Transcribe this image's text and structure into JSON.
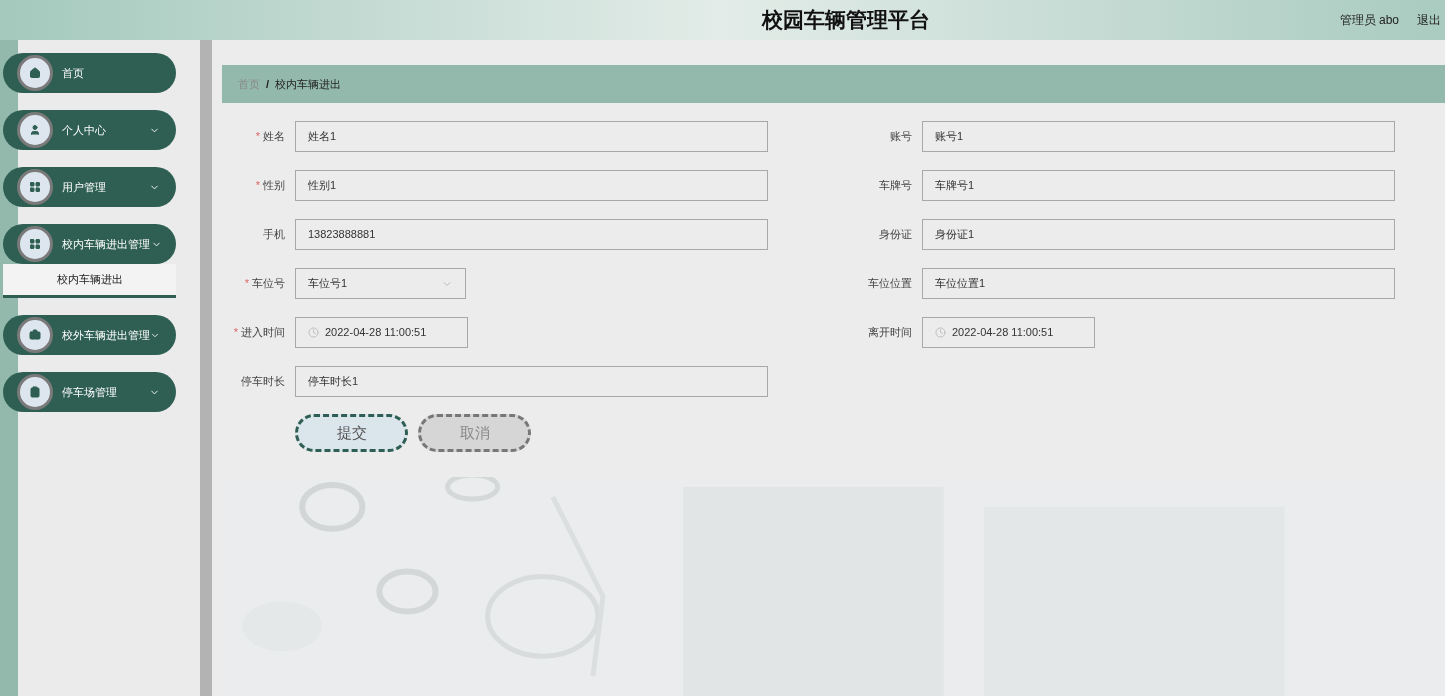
{
  "header": {
    "title": "校园车辆管理平台",
    "user": "管理员 abo",
    "logout": "退出"
  },
  "sidebar": {
    "items": [
      {
        "label": "首页",
        "kind": "link"
      },
      {
        "label": "个人中心",
        "kind": "menu",
        "expanded": false
      },
      {
        "label": "用户管理",
        "kind": "menu",
        "expanded": false
      },
      {
        "label": "校内车辆进出管理",
        "kind": "menu",
        "expanded": true,
        "children": [
          {
            "label": "校内车辆进出",
            "selected": true
          }
        ]
      },
      {
        "label": "校外车辆进出管理",
        "kind": "menu",
        "expanded": false
      },
      {
        "label": "停车场管理",
        "kind": "menu",
        "expanded": false
      }
    ]
  },
  "breadcrumb": {
    "items": [
      "首页",
      "校内车辆进出"
    ],
    "separator": "/"
  },
  "form": {
    "required_mark": "*",
    "rows": [
      [
        {
          "label": "姓名",
          "value": "姓名1",
          "required": true,
          "kind": "text"
        },
        {
          "label": "账号",
          "value": "账号1",
          "required": false,
          "kind": "text"
        }
      ],
      [
        {
          "label": "性别",
          "value": "性别1",
          "required": true,
          "kind": "text"
        },
        {
          "label": "车牌号",
          "value": "车牌号1",
          "required": false,
          "kind": "text"
        }
      ],
      [
        {
          "label": "手机",
          "value": "13823888881",
          "required": false,
          "kind": "text"
        },
        {
          "label": "身份证",
          "value": "身份证1",
          "required": false,
          "kind": "text"
        }
      ],
      [
        {
          "label": "车位号",
          "value": "车位号1",
          "required": true,
          "kind": "select"
        },
        {
          "label": "车位位置",
          "value": "车位位置1",
          "required": false,
          "kind": "text"
        }
      ],
      [
        {
          "label": "进入时间",
          "value": "2022-04-28 11:00:51",
          "required": true,
          "kind": "date"
        },
        {
          "label": "离开时间",
          "value": "2022-04-28 11:00:51",
          "required": false,
          "kind": "date"
        }
      ],
      [
        {
          "label": "停车时长",
          "value": "停车时长1",
          "required": false,
          "kind": "text"
        }
      ]
    ],
    "buttons": [
      {
        "label": "提交",
        "kind": "primary"
      },
      {
        "label": "取消",
        "kind": "secondary"
      }
    ]
  }
}
